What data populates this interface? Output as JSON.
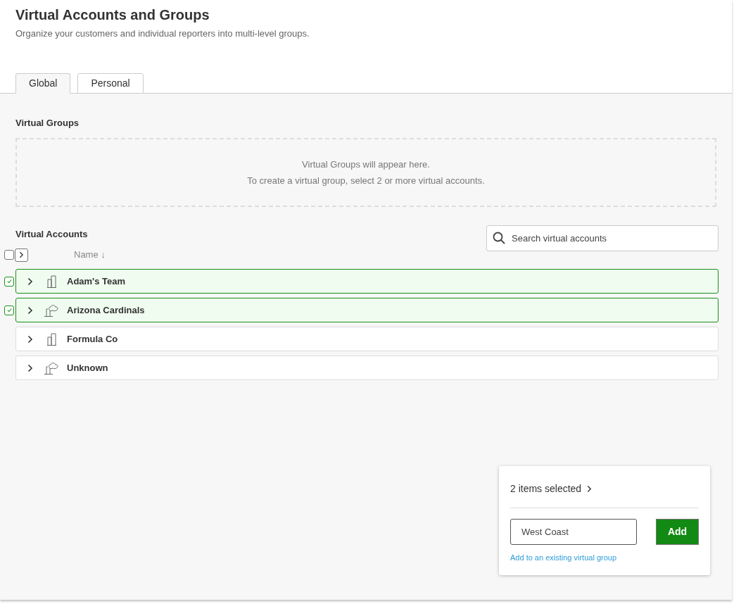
{
  "header": {
    "title": "Virtual Accounts and Groups",
    "subtitle": "Organize your customers and individual reporters into multi-level groups."
  },
  "tabs": [
    {
      "label": "Global",
      "selected": true
    },
    {
      "label": "Personal",
      "selected": false
    }
  ],
  "groups": {
    "heading": "Virtual Groups",
    "empty_lines": [
      "Virtual Groups will appear here.",
      "To create a virtual group, select 2 or more virtual accounts."
    ]
  },
  "accounts": {
    "heading": "Virtual Accounts",
    "search": {
      "placeholder": "Search virtual accounts"
    },
    "select_all": {
      "checked": false
    },
    "column": "Name",
    "sort_arrow": "↓",
    "rows": [
      {
        "name": "Adam's Team",
        "kind": "building",
        "checked": true
      },
      {
        "name": "Arizona Cardinals",
        "kind": "tree",
        "checked": true
      },
      {
        "name": "Formula Co",
        "kind": "building",
        "checked": false
      },
      {
        "name": "Unknown",
        "kind": "tree",
        "checked": false
      }
    ]
  },
  "selection_panel": {
    "count": "2 items selected",
    "input_value": "West Coast",
    "button": "Add",
    "link": "Add to an existing virtual group"
  }
}
